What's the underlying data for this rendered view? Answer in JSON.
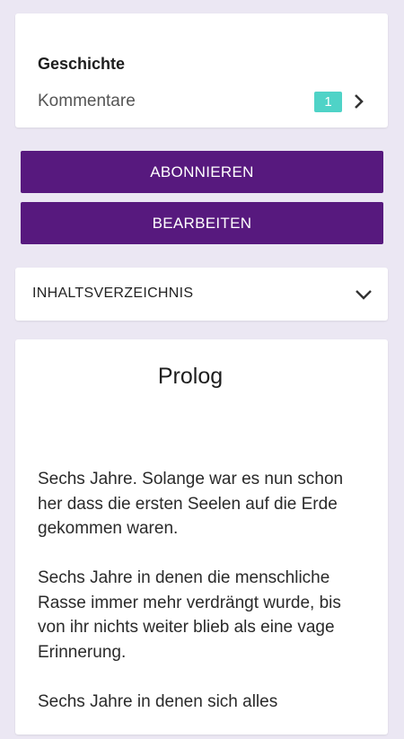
{
  "story": {
    "title": "Geschichte",
    "comments_label": "Kommentare",
    "comments_count": "1"
  },
  "actions": {
    "subscribe_label": "ABONNIEREN",
    "edit_label": "BEARBEITEN"
  },
  "toc": {
    "label": "INHALTSVERZEICHNIS"
  },
  "chapter": {
    "title": "Prolog",
    "paragraphs": [
      "Sechs Jahre. Solange war es nun schon her dass die ersten Seelen auf die Erde gekommen waren.",
      "Sechs Jahre in denen die menschliche Rasse immer mehr verdrängt wurde, bis von ihr nichts weiter blieb als eine vage Erinnerung.",
      "Sechs Jahre in denen sich alles"
    ]
  },
  "colors": {
    "background": "#ebe7f3",
    "accent_purple": "#57197e",
    "badge_teal": "#4fd3c7"
  },
  "icons": {
    "comments_chevron": "chevron-right-icon",
    "toc_chevron": "chevron-down-icon"
  }
}
